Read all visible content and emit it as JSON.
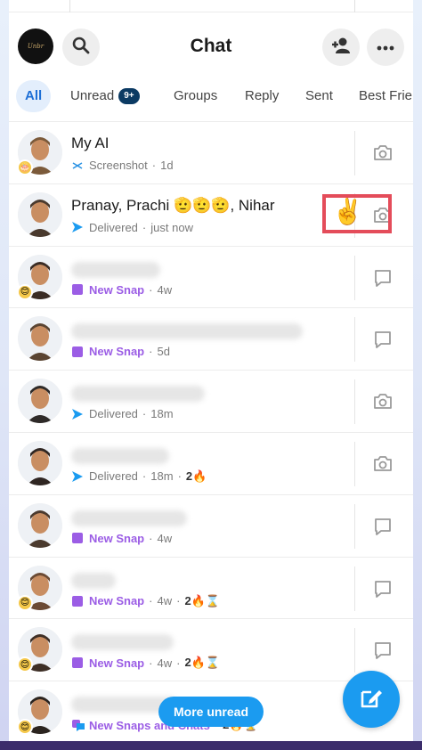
{
  "header": {
    "logo_text": "Unbr",
    "title": "Chat",
    "search_icon": "search-icon",
    "add_friend_icon": "add-friend-icon",
    "more_icon": "more-icon"
  },
  "tabs": [
    {
      "label": "All",
      "active": true
    },
    {
      "label": "Unread",
      "badge": "9+"
    },
    {
      "label": "Groups"
    },
    {
      "label": "Reply"
    },
    {
      "label": "Sent"
    },
    {
      "label": "Best Frie"
    }
  ],
  "chats": [
    {
      "name": "My AI",
      "status_icon": "screenshot-icon",
      "status": "Screenshot",
      "time": "1d",
      "right_icon": "camera-icon",
      "avatar": "ai-avatar",
      "badge": "🎂"
    },
    {
      "name": "Pranay, Prachi 🫡🫡🫡, Nihar",
      "status_icon": "sent-arrow-icon",
      "status": "Delivered",
      "time": "just now",
      "right_icon": "camera-icon",
      "avatar": "group-avatar",
      "highlight": "✌️"
    },
    {
      "name": "",
      "status_icon": "new-snap-icon",
      "status": "New Snap",
      "time": "4w",
      "right_icon": "chat-icon",
      "avatar": "bitmoji-avatar",
      "badge": "😊"
    },
    {
      "name": "",
      "status_icon": "new-snap-icon",
      "status": "New Snap",
      "time": "5d",
      "right_icon": "chat-icon",
      "avatar": "bitmoji-avatar"
    },
    {
      "name": "",
      "status_icon": "sent-arrow-icon",
      "status": "Delivered",
      "time": "18m",
      "right_icon": "camera-icon",
      "avatar": "bitmoji-avatar"
    },
    {
      "name": "",
      "status_icon": "sent-arrow-icon",
      "status": "Delivered",
      "time": "18m",
      "streak": "2🔥",
      "right_icon": "camera-icon",
      "avatar": "bitmoji-avatar"
    },
    {
      "name": "",
      "status_icon": "new-snap-icon",
      "status": "New Snap",
      "time": "4w",
      "right_icon": "chat-icon",
      "avatar": "bitmoji-avatar"
    },
    {
      "name": "",
      "status_icon": "new-snap-icon",
      "status": "New Snap",
      "time": "4w",
      "streak": "2🔥⌛",
      "right_icon": "chat-icon",
      "avatar": "bitmoji-avatar",
      "badge": "😊"
    },
    {
      "name": "",
      "status_icon": "new-snap-icon",
      "status": "New Snap",
      "time": "4w",
      "streak": "2🔥⌛",
      "right_icon": "chat-icon",
      "avatar": "bitmoji-avatar",
      "badge": "😊"
    },
    {
      "name": "",
      "status_icon": "new-snaps-chats-icon",
      "status": "New Snaps and Chats",
      "time": "",
      "streak": "2🔥⌛",
      "right_icon": "",
      "avatar": "bitmoji-avatar",
      "badge": "😊"
    }
  ],
  "more_unread": "More unread",
  "fab_icon": "new-chat-icon",
  "colors": {
    "accent": "#1b9bf0",
    "snap_purple": "#9b5de5",
    "highlight_red": "#e44c5a"
  }
}
